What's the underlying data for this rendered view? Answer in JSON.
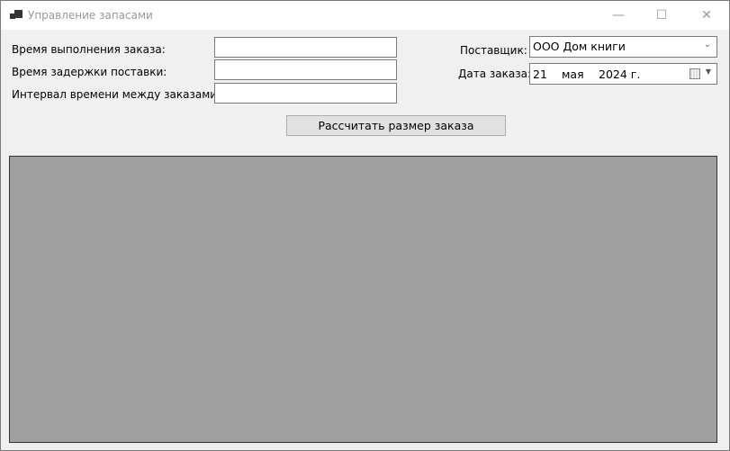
{
  "window": {
    "title": "Управление запасами",
    "minimize": "—",
    "maximize": "☐",
    "close": "✕"
  },
  "form": {
    "lead_time_label": "Время выполнения заказа:",
    "lead_time_value": "",
    "delay_label": "Время задержки поставки:",
    "delay_value": "",
    "interval_label": "Интервал времени между заказами:",
    "interval_value": "",
    "supplier_label": "Поставщик:",
    "supplier_value": "ООО Дом книги",
    "date_label": "Дата заказа:",
    "date_day": "21",
    "date_month": "мая",
    "date_year": "2024 г.",
    "calculate_label": "Рассчитать размер заказа"
  }
}
